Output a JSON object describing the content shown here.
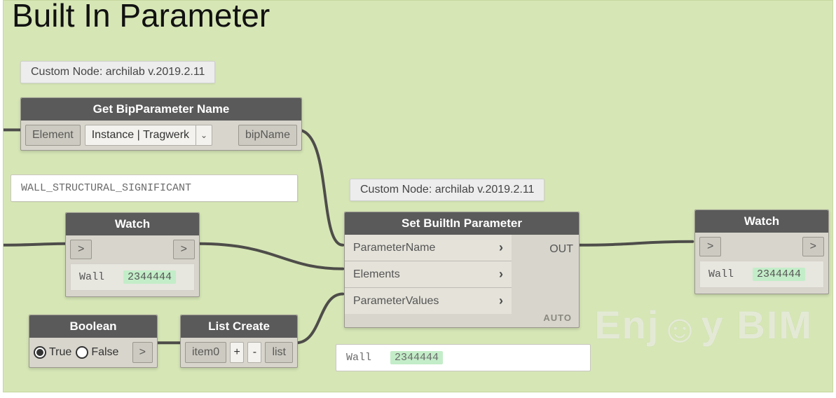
{
  "title": "Built In Parameter",
  "badges": {
    "top": "Custom Node: archilab v.2019.2.11",
    "mid": "Custom Node: archilab v.2019.2.11"
  },
  "nodes": {
    "getbip": {
      "title": "Get BipParameter Name",
      "in_port": "Element",
      "dropdown": "Instance | Tragwerk",
      "out_port": "bipName",
      "result": "WALL_STRUCTURAL_SIGNIFICANT"
    },
    "watch1": {
      "title": "Watch",
      "nav_prev": ">",
      "nav_next": ">",
      "item_label": "Wall",
      "item_id": "2344444"
    },
    "boolean": {
      "title": "Boolean",
      "opt_true": "True",
      "opt_false": "False",
      "out": ">"
    },
    "listcreate": {
      "title": "List Create",
      "in0": "item0",
      "plus": "+",
      "minus": "-",
      "out": "list"
    },
    "setparam": {
      "title": "Set BuiltIn Parameter",
      "rows": [
        "ParameterName",
        "Elements",
        "ParameterValues"
      ],
      "out": "OUT",
      "auto": "AUTO",
      "result_label": "Wall",
      "result_id": "2344444"
    },
    "watch2": {
      "title": "Watch",
      "nav_prev": ">",
      "nav_next": ">",
      "item_label": "Wall",
      "item_id": "2344444"
    }
  },
  "watermark": "Enj   y BIM"
}
